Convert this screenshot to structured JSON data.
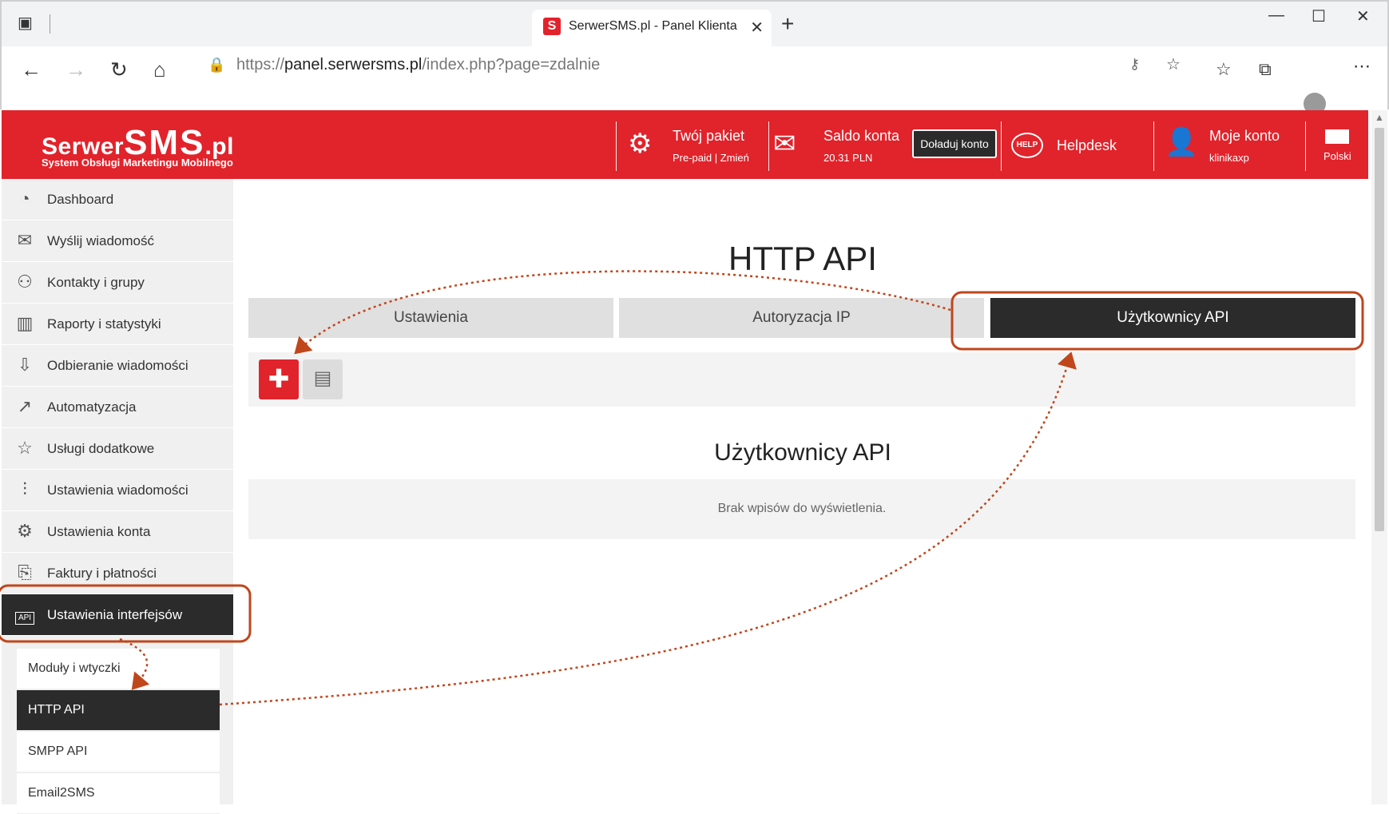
{
  "browser": {
    "tab_title": "SerwerSMS.pl - Panel Klienta",
    "favicon_letter": "S",
    "new_tab": "+",
    "url_scheme": "https://",
    "url_host": "panel.serwersms.pl",
    "url_path": "/index.php?page=zdalnie"
  },
  "header": {
    "logo_prefix": "Serwer",
    "logo_sms": "SMS",
    "logo_suffix": ".pl",
    "logo_subtitle": "System Obsługi Marketingu Mobilnego",
    "package_title": "Twój pakiet",
    "package_sub": "Pre-paid | Zmień",
    "balance_title": "Saldo konta",
    "balance_value": "20.31 PLN",
    "topup_label": "Doładuj konto",
    "helpdesk_label": "Helpdesk",
    "help_badge": "HELP",
    "account_title": "Moje konto",
    "account_user": "klinikaxp",
    "language": "Polski"
  },
  "sidebar": {
    "items": [
      {
        "label": "Dashboard",
        "icon": "dashboard-icon"
      },
      {
        "label": "Wyślij wiadomość",
        "icon": "envelope-icon"
      },
      {
        "label": "Kontakty i grupy",
        "icon": "contacts-icon"
      },
      {
        "label": "Raporty i statystyki",
        "icon": "chart-icon"
      },
      {
        "label": "Odbieranie wiadomości",
        "icon": "inbox-icon"
      },
      {
        "label": "Automatyzacja",
        "icon": "automation-icon"
      },
      {
        "label": "Usługi dodatkowe",
        "icon": "star-icon"
      },
      {
        "label": "Ustawienia wiadomości",
        "icon": "sliders-icon"
      },
      {
        "label": "Ustawienia konta",
        "icon": "gear-icon"
      },
      {
        "label": "Faktury i płatności",
        "icon": "invoice-icon"
      },
      {
        "label": "Ustawienia interfejsów",
        "icon": "api-icon",
        "api_badge": "API"
      }
    ],
    "subitems": [
      {
        "label": "Moduły i wtyczki"
      },
      {
        "label": "HTTP API"
      },
      {
        "label": "SMPP API"
      },
      {
        "label": "Email2SMS"
      }
    ]
  },
  "main": {
    "title": "HTTP API",
    "tabs": [
      {
        "label": "Ustawienia"
      },
      {
        "label": "Autoryzacja IP"
      },
      {
        "label": "Użytkownicy API"
      }
    ],
    "section_title": "Użytkownicy API",
    "empty_text": "Brak wpisów do wyświetlenia."
  },
  "colors": {
    "brand_red": "#e1232b",
    "active_dark": "#2b2b2b",
    "annotation": "#c0461c"
  }
}
